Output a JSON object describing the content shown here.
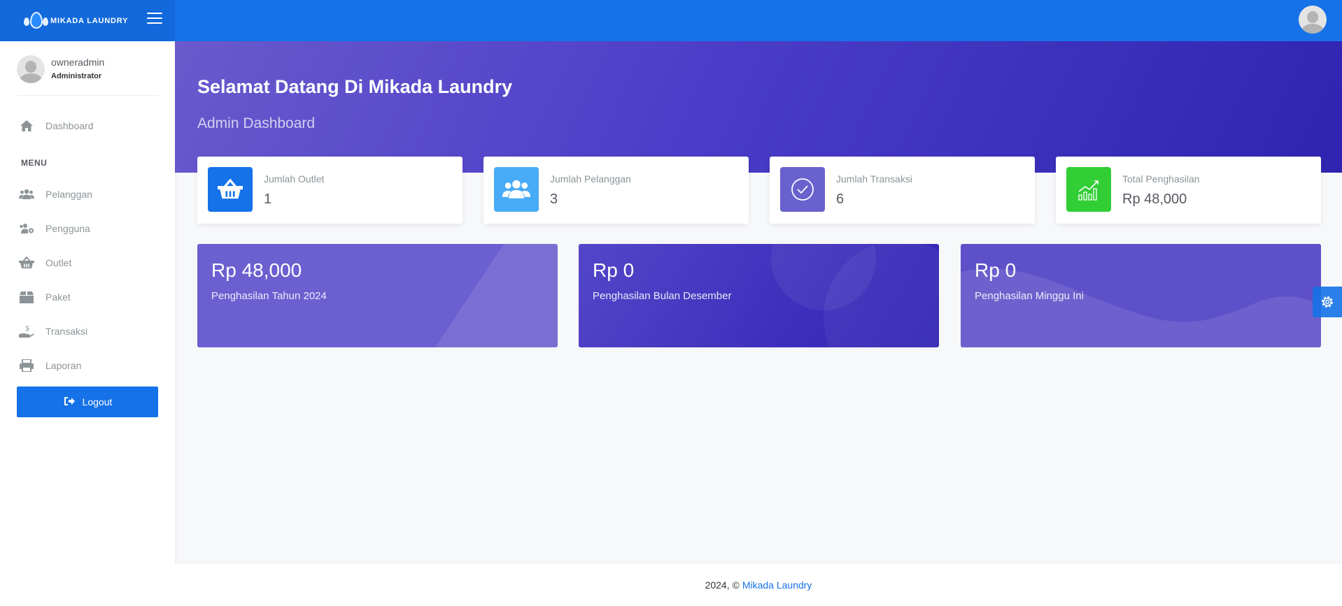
{
  "app": {
    "logo_text": "MIKADA LAUNDRY"
  },
  "user": {
    "name": "owneradmin",
    "role": "Administrator"
  },
  "sidebar": {
    "dashboard_label": "Dashboard",
    "menu_title": "MENU",
    "items": [
      {
        "label": "Pelanggan",
        "icon": "users-icon"
      },
      {
        "label": "Pengguna",
        "icon": "users-gear-icon"
      },
      {
        "label": "Outlet",
        "icon": "basket-icon"
      },
      {
        "label": "Paket",
        "icon": "box-icon"
      },
      {
        "label": "Transaksi",
        "icon": "hand-dollar-icon"
      },
      {
        "label": "Laporan",
        "icon": "printer-icon"
      }
    ],
    "logout_label": "Logout"
  },
  "hero": {
    "title": "Selamat Datang Di Mikada Laundry",
    "subtitle": "Admin Dashboard"
  },
  "stats": [
    {
      "label": "Jumlah Outlet",
      "value": "1",
      "icon": "basket-icon",
      "color": "#1572e8"
    },
    {
      "label": "Jumlah Pelanggan",
      "value": "3",
      "icon": "users-icon",
      "color": "#48abf7"
    },
    {
      "label": "Jumlah Transaksi",
      "value": "6",
      "icon": "check-circle-icon",
      "color": "#6861ce"
    },
    {
      "label": "Total Penghasilan",
      "value": "Rp 48,000",
      "icon": "growth-chart-icon",
      "color": "#31ce36"
    }
  ],
  "income": [
    {
      "value": "Rp 48,000",
      "label": "Penghasilan Tahun 2024"
    },
    {
      "value": "Rp 0",
      "label": "Penghasilan Bulan Desember"
    },
    {
      "value": "Rp 0",
      "label": "Penghasilan Minggu Ini"
    }
  ],
  "footer": {
    "prefix": "2024, ©",
    "link_text": "Mikada Laundry"
  },
  "colors": {
    "primary": "#1572e8",
    "hero_start": "#6a5acd",
    "hero_end": "#2f24b0"
  }
}
